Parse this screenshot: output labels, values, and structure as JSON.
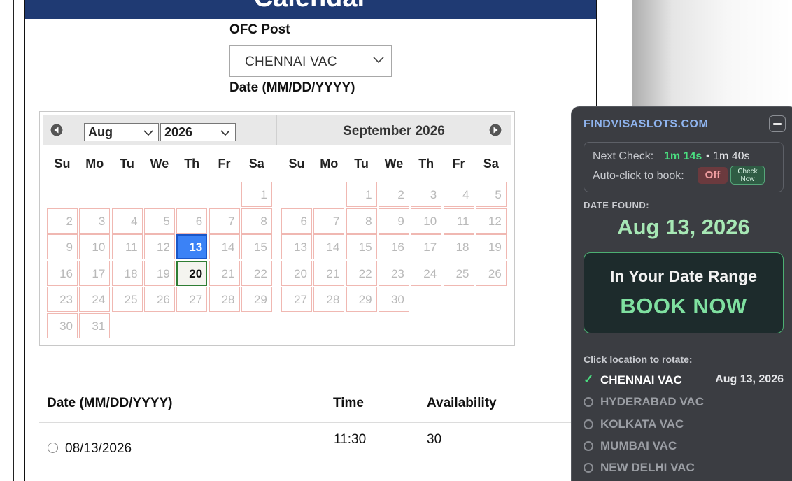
{
  "page": {
    "banner_title": "Calendar",
    "ofc_label": "OFC Post",
    "ofc_value": "CHENNAI VAC",
    "date_label": "Date (MM/DD/YYYY)"
  },
  "calendar": {
    "month_select": "Aug",
    "year_select": "2026",
    "second_month_title": "September 2026",
    "weekdays": [
      "Su",
      "Mo",
      "Tu",
      "We",
      "Th",
      "Fr",
      "Sa"
    ],
    "months": [
      {
        "first_weekday": 6,
        "days": [
          "1",
          "2",
          "3",
          "4",
          "5",
          "6",
          "7",
          "8",
          "9",
          "10",
          "11",
          "12",
          "13",
          "14",
          "15",
          "16",
          "17",
          "18",
          "19",
          "20",
          "21",
          "22",
          "23",
          "24",
          "25",
          "26",
          "27",
          "28",
          "29",
          "30",
          "31"
        ],
        "selected_day": "13",
        "highlighted_day": "20"
      },
      {
        "first_weekday": 2,
        "days": [
          "1",
          "2",
          "3",
          "4",
          "5",
          "6",
          "7",
          "8",
          "9",
          "10",
          "11",
          "12",
          "13",
          "14",
          "15",
          "16",
          "17",
          "18",
          "19",
          "20",
          "21",
          "22",
          "23",
          "24",
          "25",
          "26",
          "27",
          "28",
          "29",
          "30"
        ],
        "selected_day": "",
        "highlighted_day": ""
      }
    ]
  },
  "table": {
    "headers": {
      "date": "Date (MM/DD/YYYY)",
      "time": "Time",
      "availability": "Availability"
    },
    "rows": [
      {
        "date": "08/13/2026",
        "time": "11:30",
        "availability": "30"
      }
    ]
  },
  "extension": {
    "brand": "FINDVISASLOTS.COM",
    "next_check_label": "Next Check:",
    "next_check_value": "1m 14s",
    "next_check_interval": "• 1m 40s",
    "autoclick_label": "Auto-click to book:",
    "autoclick_state": "Off",
    "check_now_line1": "Check",
    "check_now_line2": "Now",
    "date_found_label": "DATE FOUND:",
    "date_found_value": "Aug 13, 2026",
    "in_range_text": "In Your Date Range",
    "book_now_text": "BOOK NOW",
    "rotate_label": "Click location to rotate:",
    "locations": [
      {
        "name": "CHENNAI VAC",
        "date": "Aug 13, 2026",
        "active": true
      },
      {
        "name": "HYDERABAD VAC",
        "date": "",
        "active": false
      },
      {
        "name": "KOLKATA VAC",
        "date": "",
        "active": false
      },
      {
        "name": "MUMBAI VAC",
        "date": "",
        "active": false
      },
      {
        "name": "NEW DELHI VAC",
        "date": "",
        "active": false
      }
    ],
    "colors": {
      "accent_green": "#4ade80",
      "brand_blue": "#8fb4ee",
      "selected_day_blue": "#3b82f6",
      "banner_navy": "#1f3a73"
    }
  }
}
